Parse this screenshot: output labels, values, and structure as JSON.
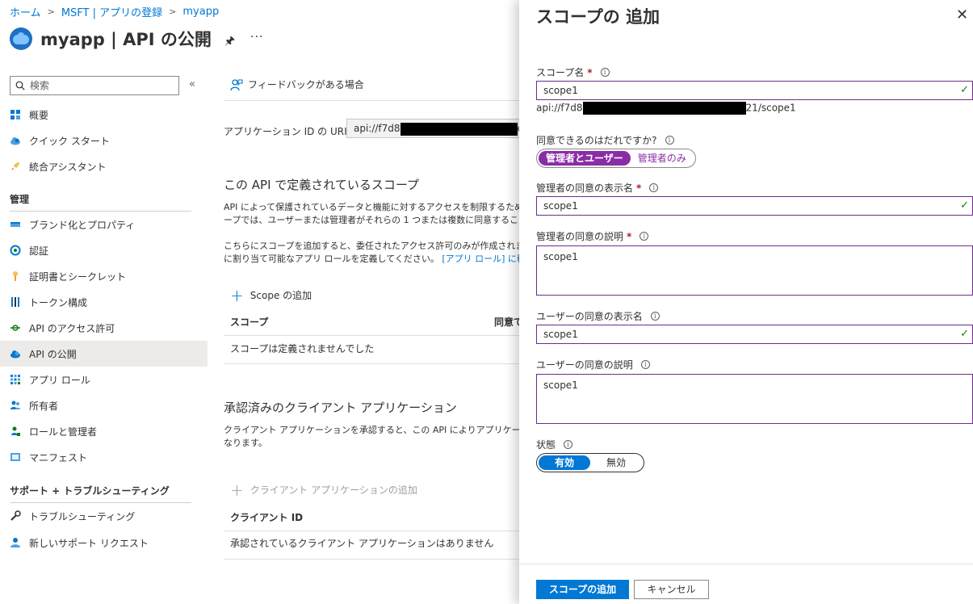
{
  "breadcrumb": [
    "ホーム",
    "MSFT | アプリの登録",
    "myapp"
  ],
  "page_title": "myapp | API の公開",
  "search": {
    "placeholder": "検索"
  },
  "sidebar": {
    "top_items": [
      {
        "label": "概要",
        "icon": "overview-icon"
      },
      {
        "label": "クイック スタート",
        "icon": "quickstart-cloud-icon"
      },
      {
        "label": "統合アシスタント",
        "icon": "rocket-icon"
      }
    ],
    "manage_heading": "管理",
    "manage_items": [
      {
        "label": "ブランド化とプロパティ",
        "icon": "branding-icon"
      },
      {
        "label": "認証",
        "icon": "authentication-icon"
      },
      {
        "label": "証明書とシークレット",
        "icon": "key-icon"
      },
      {
        "label": "トークン構成",
        "icon": "token-config-icon"
      },
      {
        "label": "API のアクセス許可",
        "icon": "api-permissions-icon"
      },
      {
        "label": "API の公開",
        "icon": "expose-api-cloud-icon",
        "selected": true
      },
      {
        "label": "アプリ ロール",
        "icon": "app-roles-icon"
      },
      {
        "label": "所有者",
        "icon": "owners-icon"
      },
      {
        "label": "ロールと管理者",
        "icon": "roles-admins-icon"
      },
      {
        "label": "マニフェスト",
        "icon": "manifest-icon"
      }
    ],
    "support_heading": "サポート + トラブルシューティング",
    "support_items": [
      {
        "label": "トラブルシューティング",
        "icon": "wrench-icon"
      },
      {
        "label": "新しいサポート リクエスト",
        "icon": "support-person-icon"
      }
    ]
  },
  "main": {
    "feedback": "フィードバックがある場合",
    "uri_label": "アプリケーション ID の URI",
    "uri_value_start": "api://f7d8",
    "uri_value_end": "e",
    "scopes_heading": "この API で定義されているスコープ",
    "scopes_desc": [
      "API によって保護されているデータと機能に対するアクセスを制限するための",
      "ープでは、ユーザーまたは管理者がそれらの 1 つまたは複数に同意することを"
    ],
    "scopes_desc2_line1": "こちらにスコープを追加すると、委任されたアクセス許可のみが作成されます",
    "scopes_desc2_line2": "に割り当て可能なアプリ ロールを定義してください。",
    "scopes_link": "[アプリ ロール] に移動",
    "add_scope": "Scope の追加",
    "scope_col": "スコープ",
    "consent_col": "同意で",
    "no_scopes": "スコープは定義されませんでした",
    "clients_heading": "承認済みのクライアント アプリケーション",
    "clients_desc_line1": "クライアント アプリケーションを承認すると、この API によりアプリケーションが",
    "clients_desc_line2": "なります。",
    "add_client": "クライアント アプリケーションの追加",
    "client_id_col": "クライアント ID",
    "no_clients": "承認されているクライアント アプリケーションはありません"
  },
  "panel": {
    "title": "スコープの 追加",
    "scope_name_label": "スコープ名",
    "scope_name_value": "scope1",
    "scope_uri_start": "api://f7d8",
    "scope_uri_end": "21/scope1",
    "who_consent_label": "同意できるのはだれですか?",
    "who_consent_options": [
      "管理者とユーザー",
      "管理者のみ"
    ],
    "admin_display_label": "管理者の同意の表示名",
    "admin_display_value": "scope1",
    "admin_desc_label": "管理者の同意の説明",
    "admin_desc_value": "scope1",
    "user_display_label": "ユーザーの同意の表示名",
    "user_display_value": "scope1",
    "user_desc_label": "ユーザーの同意の説明",
    "user_desc_value": "scope1",
    "state_label": "状態",
    "state_options": [
      "有効",
      "無効"
    ],
    "add_button": "スコープの追加",
    "cancel_button": "キャンセル"
  },
  "colors": {
    "accent": "#0078d4",
    "consent_toggle": "#8a2da5",
    "field_border": "#6b2e8a",
    "valid_check": "#107c10"
  }
}
